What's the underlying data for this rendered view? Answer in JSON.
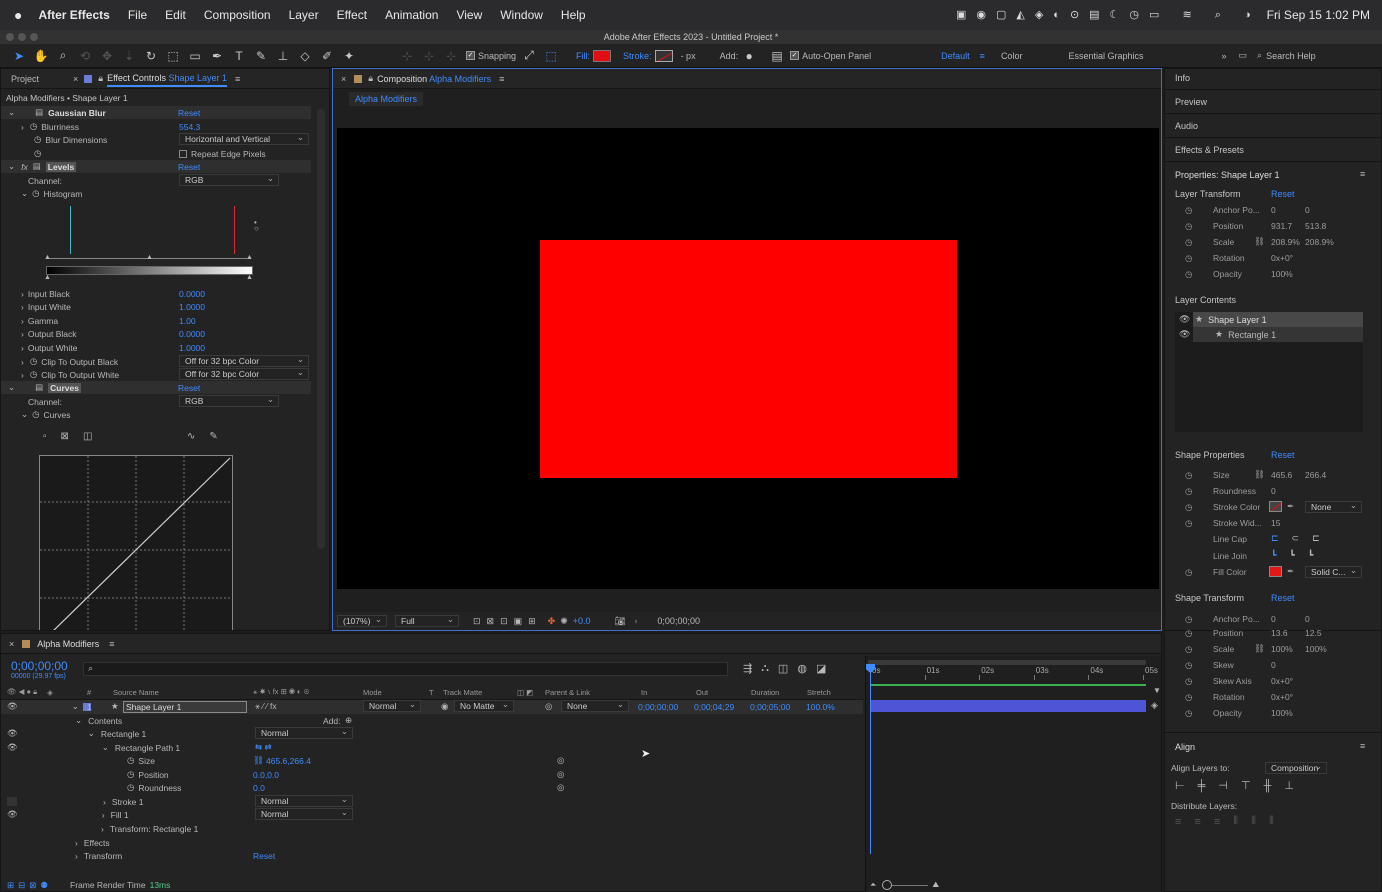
{
  "menubar": {
    "app": "After Effects",
    "items": [
      "File",
      "Edit",
      "Composition",
      "Layer",
      "Effect",
      "Animation",
      "View",
      "Window",
      "Help"
    ],
    "datetime": "Fri Sep 15  1:02 PM"
  },
  "window_title": "Adobe After Effects 2023 - Untitled Project *",
  "toolbar": {
    "snapping": "Snapping",
    "fill": "Fill:",
    "stroke": "Stroke:",
    "px": "- px",
    "add": "Add:",
    "auto_open": "Auto-Open Panel",
    "workspaces": [
      "Default",
      "Color",
      "Essential Graphics"
    ],
    "search": "Search Help"
  },
  "left_panel": {
    "tab_project": "Project",
    "tab_effect": "Effect Controls",
    "tab_effect_layer": "Shape Layer 1",
    "breadcrumb": "Alpha Modifiers • Shape Layer 1",
    "gaussian": {
      "name": "Gaussian Blur",
      "reset": "Reset",
      "blurriness_label": "Blurriness",
      "blurriness": "554.3",
      "dims_label": "Blur Dimensions",
      "dims": "Horizontal and Vertical",
      "repeat": "Repeat Edge Pixels"
    },
    "levels": {
      "name": "Levels",
      "reset": "Reset",
      "channel_label": "Channel:",
      "channel": "RGB",
      "histogram": "Histogram",
      "params": [
        {
          "label": "Input Black",
          "value": "0.0000"
        },
        {
          "label": "Input White",
          "value": "1.0000"
        },
        {
          "label": "Gamma",
          "value": "1.00"
        },
        {
          "label": "Output Black",
          "value": "0.0000"
        },
        {
          "label": "Output White",
          "value": "1.0000"
        }
      ],
      "clip_black_label": "Clip To Output Black",
      "clip_black": "Off for 32 bpc Color",
      "clip_white_label": "Clip To Output White",
      "clip_white": "Off for 32 bpc Color"
    },
    "curves": {
      "name": "Curves",
      "reset": "Reset",
      "channel_label": "Channel:",
      "channel": "RGB",
      "curves_label": "Curves"
    }
  },
  "comp": {
    "tab": "Composition",
    "tab_name": "Alpha Modifiers",
    "crumb": "Alpha Modifiers",
    "zoom": "(107%)",
    "quality": "Full",
    "exposure": "+0.0",
    "timecode": "0;00;00;00",
    "shape_color": "#ff0000"
  },
  "right": {
    "sections": [
      "Info",
      "Preview",
      "Audio",
      "Effects & Presets"
    ],
    "props_title": "Properties: Shape Layer 1",
    "layer_transform": {
      "title": "Layer Transform",
      "reset": "Reset",
      "rows": [
        {
          "label": "Anchor Po...",
          "v1": "0",
          "v2": "0"
        },
        {
          "label": "Position",
          "v1": "931.7",
          "v2": "513.8"
        },
        {
          "label": "Scale",
          "v1": "208.9%",
          "v2": "208.9%"
        },
        {
          "label": "Rotation",
          "v1": "0x+0°",
          "v2": ""
        },
        {
          "label": "Opacity",
          "v1": "100%",
          "v2": ""
        }
      ]
    },
    "layer_contents": {
      "title": "Layer Contents",
      "items": [
        "Shape Layer 1",
        "Rectangle 1"
      ]
    },
    "shape_props": {
      "title": "Shape Properties",
      "reset": "Reset",
      "size_label": "Size",
      "size1": "465.6",
      "size2": "266.4",
      "roundness_label": "Roundness",
      "roundness": "0",
      "stroke_color_label": "Stroke Color",
      "stroke_none": "None",
      "stroke_width_label": "Stroke Wid...",
      "stroke_width": "15",
      "line_cap_label": "Line Cap",
      "line_join_label": "Line Join",
      "fill_color_label": "Fill Color",
      "fill_type": "Solid C...",
      "fill_color": "#e01818"
    },
    "shape_transform": {
      "title": "Shape Transform",
      "reset": "Reset",
      "rows": [
        {
          "label": "Anchor Po...",
          "v1": "0",
          "v2": "0"
        },
        {
          "label": "Position",
          "v1": "13.6",
          "v2": "12.5"
        },
        {
          "label": "Scale",
          "v1": "100%",
          "v2": "100%"
        },
        {
          "label": "Skew",
          "v1": "0",
          "v2": ""
        },
        {
          "label": "Skew Axis",
          "v1": "0x+0°",
          "v2": ""
        },
        {
          "label": "Rotation",
          "v1": "0x+0°",
          "v2": ""
        },
        {
          "label": "Opacity",
          "v1": "100%",
          "v2": ""
        }
      ]
    },
    "align": {
      "title": "Align",
      "align_to_label": "Align Layers to:",
      "align_to": "Composition",
      "distribute": "Distribute Layers:"
    }
  },
  "timeline": {
    "tab": "Alpha Modifiers",
    "timecode": "0;00;00;00",
    "fps": "00000 (29.97 fps)",
    "headers": {
      "num": "#",
      "source": "Source Name",
      "mode": "Mode",
      "t": "T",
      "track": "Track Matte",
      "parent": "Parent & Link",
      "in": "In",
      "out": "Out",
      "duration": "Duration",
      "stretch": "Stretch"
    },
    "layer": {
      "num": "1",
      "name": "Shape Layer 1",
      "mode": "Normal",
      "matte": "No Matte",
      "parent": "None",
      "in": "0;00;00;00",
      "out": "0;00;04;29",
      "duration": "0;00;05;00",
      "stretch": "100.0%"
    },
    "tree": {
      "contents": "Contents",
      "add": "Add:",
      "rect": "Rectangle 1",
      "rect_mode": "Normal",
      "path": "Rectangle Path 1",
      "size": "Size",
      "size_val": "465.6,266.4",
      "position": "Position",
      "position_val": "0.0,0.0",
      "roundness": "Roundness",
      "roundness_val": "0.0",
      "stroke": "Stroke 1",
      "stroke_mode": "Normal",
      "fill": "Fill 1",
      "fill_mode": "Normal",
      "transform_rect": "Transform: Rectangle 1",
      "effects": "Effects",
      "transform": "Transform",
      "transform_reset": "Reset"
    },
    "ruler": [
      "0s",
      "01s",
      "02s",
      "03s",
      "04s",
      "05s"
    ],
    "frame_render_label": "Frame Render Time",
    "frame_render_value": "13ms"
  }
}
